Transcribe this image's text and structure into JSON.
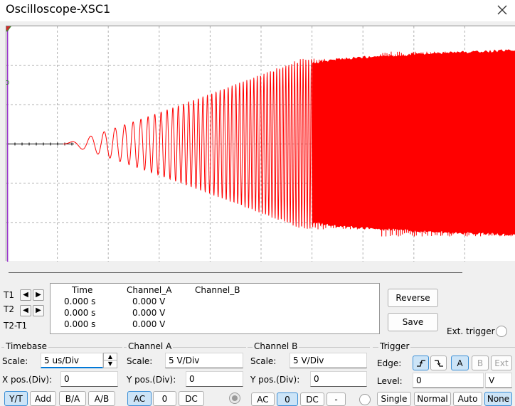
{
  "window": {
    "title": "Oscilloscope-XSC1"
  },
  "readout": {
    "t1_label": "T1",
    "t2_label": "T2",
    "t2t1_label": "T2-T1",
    "headers": {
      "time": "Time",
      "channel_a": "Channel_A",
      "channel_b": "Channel_B"
    },
    "rows": [
      {
        "time": "0.000 s",
        "channel_a": "0.000 V"
      },
      {
        "time": "0.000 s",
        "channel_a": "0.000 V"
      },
      {
        "time": "0.000 s",
        "channel_a": "0.000 V"
      }
    ],
    "reverse_label": "Reverse",
    "save_label": "Save",
    "ext_trigger_label": "Ext. trigger"
  },
  "timebase": {
    "title": "Timebase",
    "scale_label": "Scale:",
    "scale_value": "5 us/Div",
    "xpos_label": "X pos.(Div):",
    "xpos_value": "0",
    "modes": [
      "Y/T",
      "Add",
      "B/A",
      "A/B"
    ]
  },
  "channel_a": {
    "title": "Channel A",
    "scale_label": "Scale:",
    "scale_value": "5  V/Div",
    "ypos_label": "Y pos.(Div):",
    "ypos_value": "0",
    "coupling": [
      "AC",
      "0",
      "DC"
    ]
  },
  "channel_b": {
    "title": "Channel B",
    "scale_label": "Scale:",
    "scale_value": "5  V/Div",
    "ypos_label": "Y pos.(Div):",
    "ypos_value": "0",
    "coupling": [
      "AC",
      "0",
      "DC",
      "-"
    ]
  },
  "trigger": {
    "title": "Trigger",
    "edge_label": "Edge:",
    "sources": [
      "A",
      "B",
      "Ext"
    ],
    "level_label": "Level:",
    "level_value": "0",
    "level_unit": "V",
    "modes": [
      "Single",
      "Normal",
      "Auto",
      "None"
    ]
  },
  "colors": {
    "trace_a": "#ff0000",
    "grid": "#b0b0b0",
    "cursor": "#9933cc",
    "accent": "#0078d7"
  },
  "icons": {
    "close": "close-icon",
    "cursor_marker": "cursor-triangle-icon",
    "rising_edge": "rising-edge-icon",
    "falling_edge": "falling-edge-icon"
  }
}
